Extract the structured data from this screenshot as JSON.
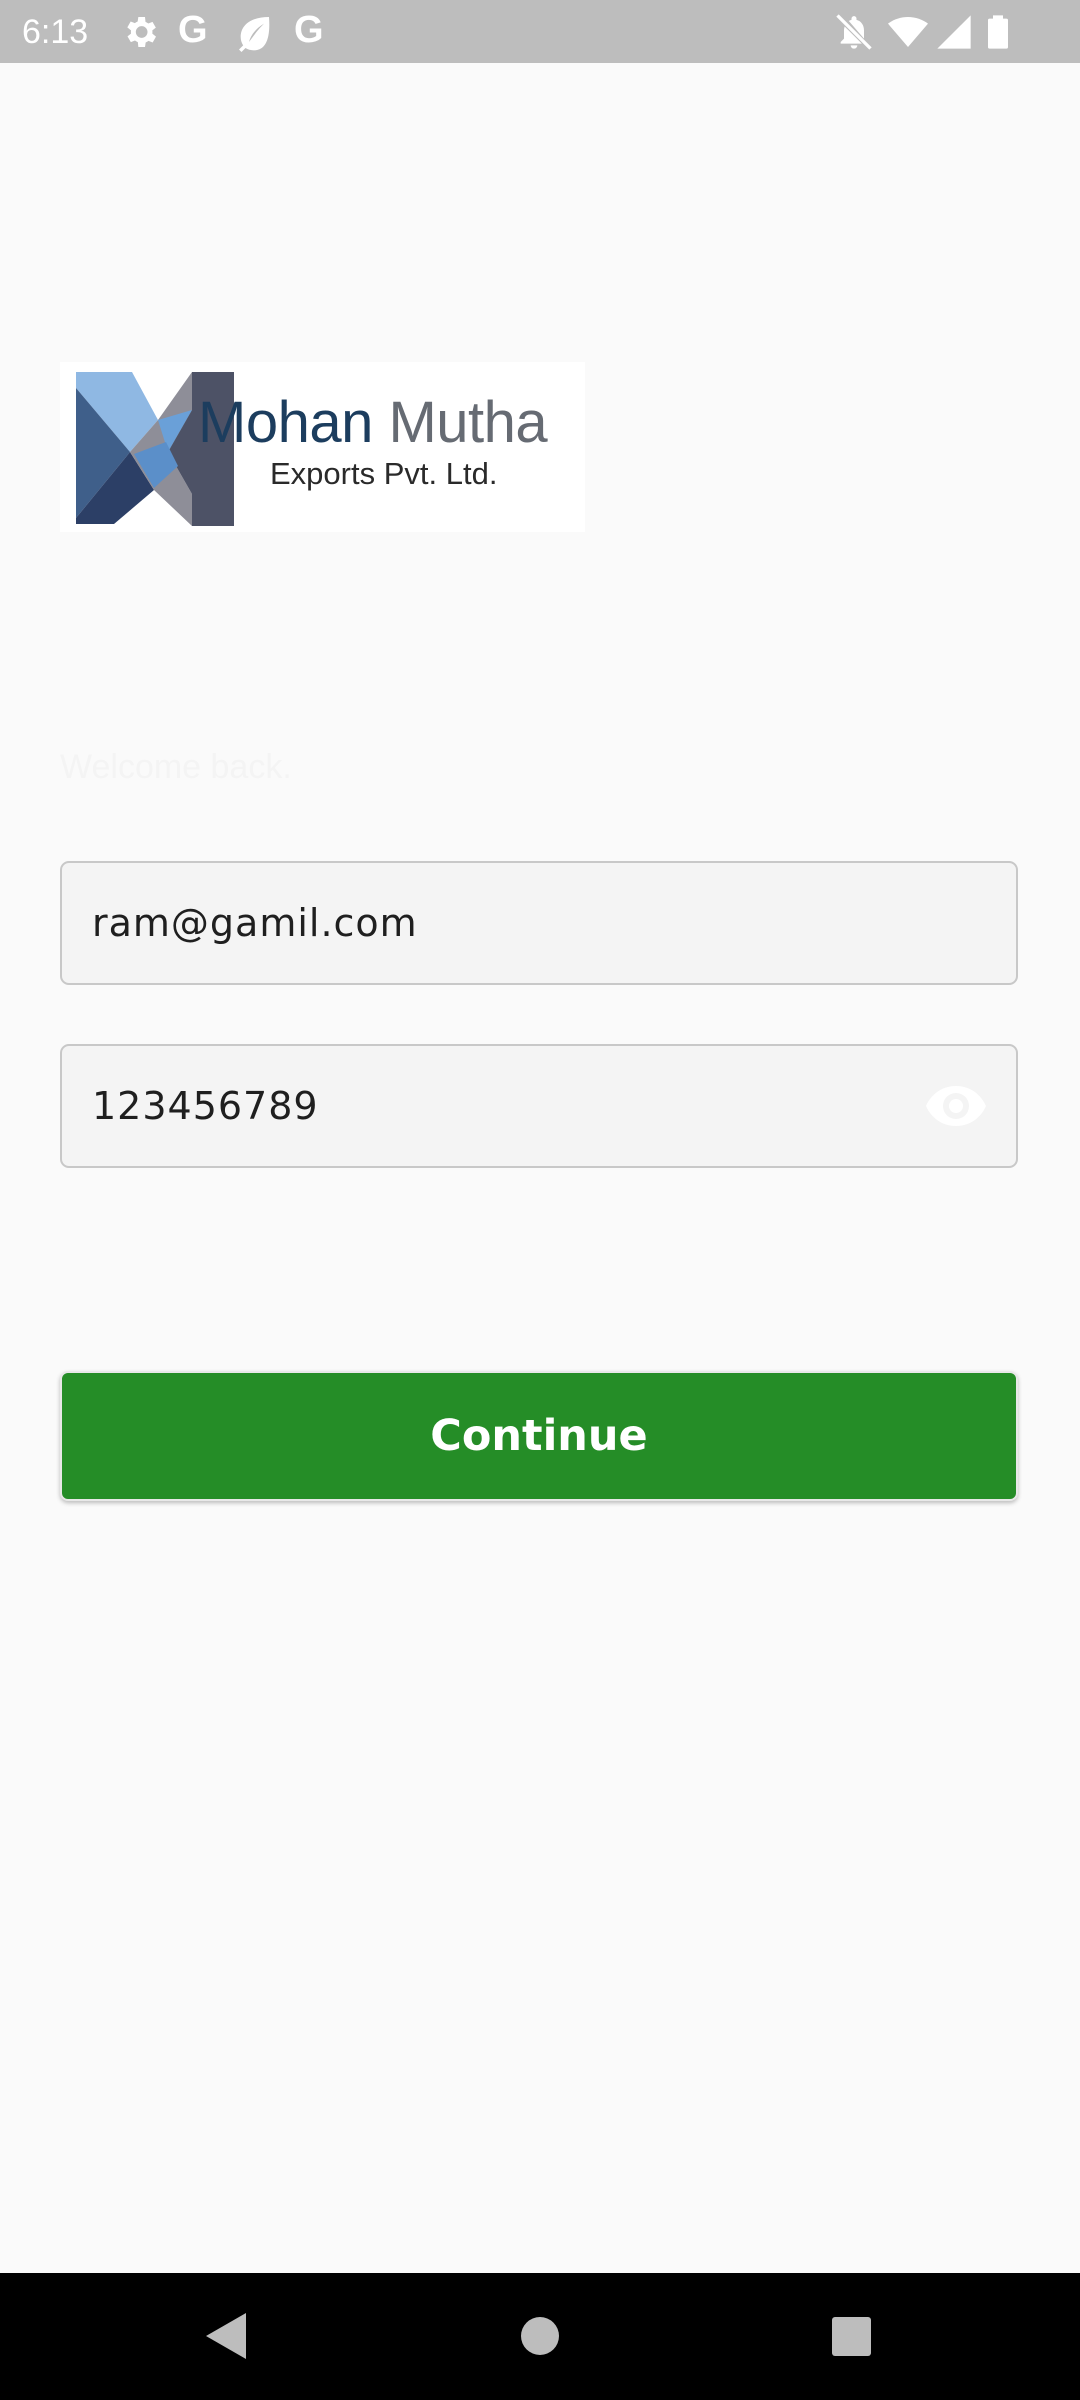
{
  "status_bar": {
    "time": "6:13",
    "left_icons": [
      "gear-icon",
      "google-g-icon",
      "leaf-icon",
      "google-g-icon"
    ],
    "right_icons": [
      "bell-off-icon",
      "wifi-icon",
      "signal-icon",
      "battery-icon"
    ],
    "g_letter": "G"
  },
  "logo": {
    "name_part1": "Mohan",
    "name_part2": "Mutha",
    "subtitle": "Exports Pvt. Ltd."
  },
  "welcome_text": "Welcome back.",
  "email_field": {
    "value": "ram@gamil.com"
  },
  "password_field": {
    "value": "123456789",
    "toggle_icon": "eye-icon"
  },
  "continue_button": {
    "label": "Continue"
  },
  "colors": {
    "primary": "#258d27",
    "status_bar": "#bdbdbd",
    "background": "#fafafa",
    "nav_bar": "#000000"
  },
  "nav_bar": {
    "buttons": [
      "back-icon",
      "home-icon",
      "recents-icon"
    ]
  }
}
